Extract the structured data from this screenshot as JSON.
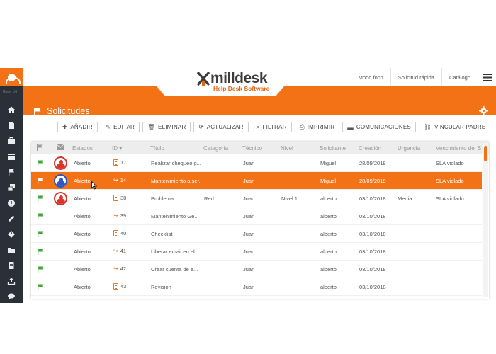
{
  "brand": {
    "name": "milldesk",
    "tagline": "Help Desk Software"
  },
  "sidebar": {
    "tiny_label": "Bienv Ud"
  },
  "toplinks": [
    "Modo foco",
    "Solicitud rápida",
    "Catálogo"
  ],
  "page": {
    "title": "Solicitudes"
  },
  "toolbar": [
    "AÑADIR",
    "EDITAR",
    "ELIMINAR",
    "ACTUALIZAR",
    "FILTRAR",
    "IMPRIMIR",
    "COMUNICACIONES",
    "VINCULAR PADRE"
  ],
  "columns": {
    "estados": "Estados",
    "id": "ID",
    "titulo": "Título",
    "categoria": "Categoría",
    "tecnico": "Técnico",
    "nivel": "Nivel",
    "solicitante": "Solicitante",
    "creacion": "Creación",
    "urgencia": "Urgencia",
    "vencimiento": "Vencimiento del S"
  },
  "rows": [
    {
      "estado": "Abierto",
      "id": "17",
      "titulo": "Realizar chequeo g...",
      "categoria": "",
      "tecnico": "Juan",
      "nivel": "",
      "solicitante": "Miguel",
      "creacion": "28/09/2018",
      "urgencia": "",
      "vencimiento": "SLA violado"
    },
    {
      "estado": "Abierto",
      "id": "14",
      "titulo": "Mantenimiento a ser...",
      "categoria": "",
      "tecnico": "Juan",
      "nivel": "",
      "solicitante": "Miguel",
      "creacion": "28/09/2018",
      "urgencia": "",
      "vencimiento": "SLA violado"
    },
    {
      "estado": "Abierto",
      "id": "38",
      "titulo": "Problema",
      "categoria": "Red",
      "tecnico": "Juan",
      "nivel": "Nivel 1",
      "solicitante": "alberto",
      "creacion": "03/10/2018",
      "urgencia": "Media",
      "vencimiento": "SLA violado"
    },
    {
      "estado": "Abierto",
      "id": "39",
      "titulo": "Mantenimiento Ge...",
      "categoria": "",
      "tecnico": "Juan",
      "nivel": "",
      "solicitante": "alberto",
      "creacion": "03/10/2018",
      "urgencia": "",
      "vencimiento": ""
    },
    {
      "estado": "Abierto",
      "id": "40",
      "titulo": "Checklist",
      "categoria": "",
      "tecnico": "Juan",
      "nivel": "",
      "solicitante": "alberto",
      "creacion": "03/10/2018",
      "urgencia": "",
      "vencimiento": ""
    },
    {
      "estado": "Abierto",
      "id": "41",
      "titulo": "Liberar email en el ...",
      "categoria": "",
      "tecnico": "Juan",
      "nivel": "",
      "solicitante": "alberto",
      "creacion": "03/10/2018",
      "urgencia": "",
      "vencimiento": ""
    },
    {
      "estado": "Abierto",
      "id": "42",
      "titulo": "Crear cuenta de e...",
      "categoria": "",
      "tecnico": "Juan",
      "nivel": "",
      "solicitante": "alberto",
      "creacion": "03/10/2018",
      "urgencia": "",
      "vencimiento": ""
    },
    {
      "estado": "Abierto",
      "id": "43",
      "titulo": "Revisión",
      "categoria": "",
      "tecnico": "Juan",
      "nivel": "",
      "solicitante": "alberto",
      "creacion": "03/10/2018",
      "urgencia": "",
      "vencimiento": ""
    }
  ],
  "colors": {
    "accent": "#f47216",
    "sidebar": "#2b3038",
    "flag": "#3fa535",
    "avatar_red": "#d9362b",
    "avatar_blue": "#2b58c6"
  }
}
